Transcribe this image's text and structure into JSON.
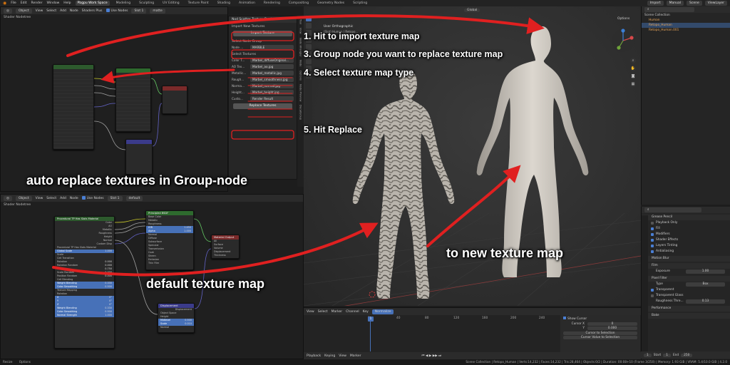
{
  "topbar": {
    "menus": [
      "File",
      "Edit",
      "Render",
      "Window",
      "Help"
    ],
    "workspaces": [
      "Pbgpu Work Space",
      "Modeling",
      "Sculpting",
      "UV Editing",
      "Texture Paint",
      "Shading",
      "Animation",
      "Rendering",
      "Compositing",
      "Geometry Nodes",
      "Scripting"
    ],
    "active_workspace": "Pbgpu Work Space",
    "right_buttons": [
      "Import",
      "Manual"
    ],
    "scene_label": "Scene",
    "viewlayer_label": "ViewLayer"
  },
  "top_editor": {
    "header": [
      "Object",
      "View",
      "Select",
      "Add",
      "Node",
      "Shaders Plus",
      "Use Nodes"
    ],
    "slot": "Slot 1",
    "material": "matte",
    "breadcrumb": "Shader Nodetree"
  },
  "bottom_editor": {
    "header": [
      "Object",
      "View",
      "Select",
      "Add",
      "Node",
      "Use Nodes"
    ],
    "slot": "Slot 1",
    "material": "default",
    "breadcrumb": "Shader Nodetree",
    "nodes": {
      "group": {
        "title": "Procedural TP Has Slots Material",
        "rows": [
          "Color",
          "AO",
          "Metallic",
          "Roughness",
          "Height",
          "Normal",
          "Custom Disp"
        ],
        "sub_title": "Procedural TP Has Slots Material",
        "mapping_rows": [
          "Global Scale",
          "Scale",
          "Cell Transition",
          "Rotation",
          "Rotation Random",
          "Scale",
          "Scale Random",
          "Position Random"
        ],
        "mapping_vals": [
          "1.000",
          "",
          "",
          "0.000",
          "0.000",
          "0.750",
          "0.000",
          "0.000"
        ],
        "cell_blending": "Cell Blending",
        "blend_rows": [
          "Weight Blending",
          "Color Smoothing"
        ],
        "blend_vals": [
          "0.330",
          "0.500"
        ],
        "texture_mapping": "Texture Mapping",
        "rotation": "Rotation",
        "rot_rows": [
          "X",
          "Y",
          "Z"
        ],
        "rot_vals": [
          "0°",
          "0°",
          "0°"
        ],
        "bottom_rows": [
          "Weight Blending",
          "Color Smoothing",
          "Normal Strength"
        ],
        "bottom_vals": [
          "0.330",
          "0.500",
          "1.000"
        ]
      },
      "bsdf": {
        "title": "Principled BSDF",
        "rows": [
          "Base Color",
          "Metallic",
          "Roughness",
          "IOR",
          "Alpha",
          "Normal",
          "Diffuse",
          "Subsurface",
          "Specular",
          "Transmission",
          "Coat",
          "Sheen",
          "Emission",
          "Thin Film"
        ],
        "vals": [
          "",
          "",
          "",
          "1.450",
          "1.000",
          "",
          "",
          "",
          "",
          "",
          "",
          "",
          "",
          ""
        ]
      },
      "output": {
        "title": "Material Output",
        "rows": [
          "All",
          "Surface",
          "Volume",
          "Displacement",
          "Thickness"
        ]
      },
      "displacement": {
        "title": "Displacement",
        "rows": [
          "Displacement",
          "Object Space",
          "Height",
          "Midlevel",
          "Scale",
          "Normal"
        ],
        "vals": [
          "",
          "",
          "",
          "0.500",
          "0.010",
          ""
        ]
      }
    }
  },
  "addon_panel": {
    "title": "Nod Scatter Texture Replacer",
    "import_section": "Import New Textures",
    "import_button": "Import Texture",
    "select_group_section": "Select Node Group",
    "node_label": "Node ...",
    "node_value": "MARBLE",
    "select_textures_section": "Select Textures",
    "fields": [
      {
        "label": "Color T...",
        "value": "Marbel_diffuseOriginal..."
      },
      {
        "label": "AO Tex...",
        "value": "Marbel_ao.jpg"
      },
      {
        "label": "Metallic...",
        "value": "Marbel_metallic.jpg"
      },
      {
        "label": "Rough...",
        "value": "Marbel_smoothness.jpg"
      },
      {
        "label": "Norma...",
        "value": "Marbel_normal.jpg"
      },
      {
        "label": "Height...",
        "value": "Marbel_height.jpg"
      },
      {
        "label": "Custo...",
        "value": "Render Result"
      }
    ],
    "replace_button": "Replace Textures"
  },
  "sidetabs": [
    "Tool",
    "View",
    "Node Wrangler",
    "Node",
    "Options",
    "Node Preview",
    "DecalGroup"
  ],
  "viewport": {
    "header": [
      "User Orthographic",
      "(Slot) Human | Retopo..."
    ],
    "orientation": "Global",
    "options_label": "Options"
  },
  "outliner": {
    "title": "Scene Collection",
    "items": [
      "Scene Collection",
      "Human",
      "Retopo_Human",
      "Retopo_Human.001"
    ]
  },
  "properties": {
    "sections": [
      {
        "type": "head",
        "label": "Grease Pencil"
      },
      {
        "type": "check",
        "label": "Playback Only",
        "on": false
      },
      {
        "type": "check",
        "label": "Fill",
        "on": true
      },
      {
        "type": "check",
        "label": "Modifiers",
        "on": true
      },
      {
        "type": "check",
        "label": "Shader Effects",
        "on": true
      },
      {
        "type": "check",
        "label": "Layers Tinting",
        "on": true
      },
      {
        "type": "check",
        "label": "Antialiasing",
        "on": true
      },
      {
        "type": "head",
        "label": "Motion Blur"
      },
      {
        "type": "head",
        "label": "Film"
      },
      {
        "type": "field",
        "label": "Exposure",
        "value": "1.00"
      },
      {
        "type": "head",
        "label": "Pixel Filter"
      },
      {
        "type": "field",
        "label": "Type",
        "value": "Box"
      },
      {
        "type": "check",
        "label": "Transparent",
        "on": true
      },
      {
        "type": "check",
        "label": "Transparent Glass",
        "on": false
      },
      {
        "type": "field",
        "label": "Roughness Thre...",
        "value": "0.13"
      },
      {
        "type": "head",
        "label": "Performance"
      },
      {
        "type": "head",
        "label": "Bake"
      }
    ]
  },
  "timeline": {
    "header": [
      "View",
      "Select",
      "Marker",
      "Channel",
      "Key",
      "Normalize"
    ],
    "ticks": [
      "0",
      "40",
      "80",
      "120",
      "160",
      "200",
      "240"
    ],
    "current_frame": "1",
    "show_cursor": "Show Cursor",
    "cursor_x_label": "Cursor X",
    "cursor_x": "0",
    "cursor_y_label": "Y",
    "cursor_y": "0.000",
    "cursor_to_selection": "Cursor to Selection",
    "cursor_value_to_selection": "Cursor Value to Selection",
    "playback": [
      "Playback",
      "Keying",
      "View",
      "Marker"
    ],
    "start_label": "Start",
    "start": "1",
    "end_label": "End",
    "end": "250"
  },
  "status": {
    "left": "Resize",
    "options": "Options",
    "right": "Scene Collection | Retopo_Human | Verts:14,232 | Faces:14,232 | Tris:28,464 | Objects:0/2 | Duration: 00:08+10 (Frame 3/250) | Memory: 1.93 GiB | VRAM: 5.4/10.0 GiB | 4.2.0"
  },
  "overlays": {
    "steps": [
      "1. Hit to import texture map",
      "3. Group node you  want to replace texture map",
      "4. Select texture map type",
      "5. Hit Replace"
    ],
    "auto": "auto replace textures in Group-node",
    "default_map": "default texture map",
    "new_map": "to new texture map"
  },
  "colors": {
    "accent": "#4a7fd4",
    "arrow": "#e02020",
    "node_group_header": "#2d5a2d",
    "node_bsdf_header": "#2e6a2e",
    "node_output_header": "#7a2a2a",
    "node_vector_header": "#3b3b8a"
  }
}
